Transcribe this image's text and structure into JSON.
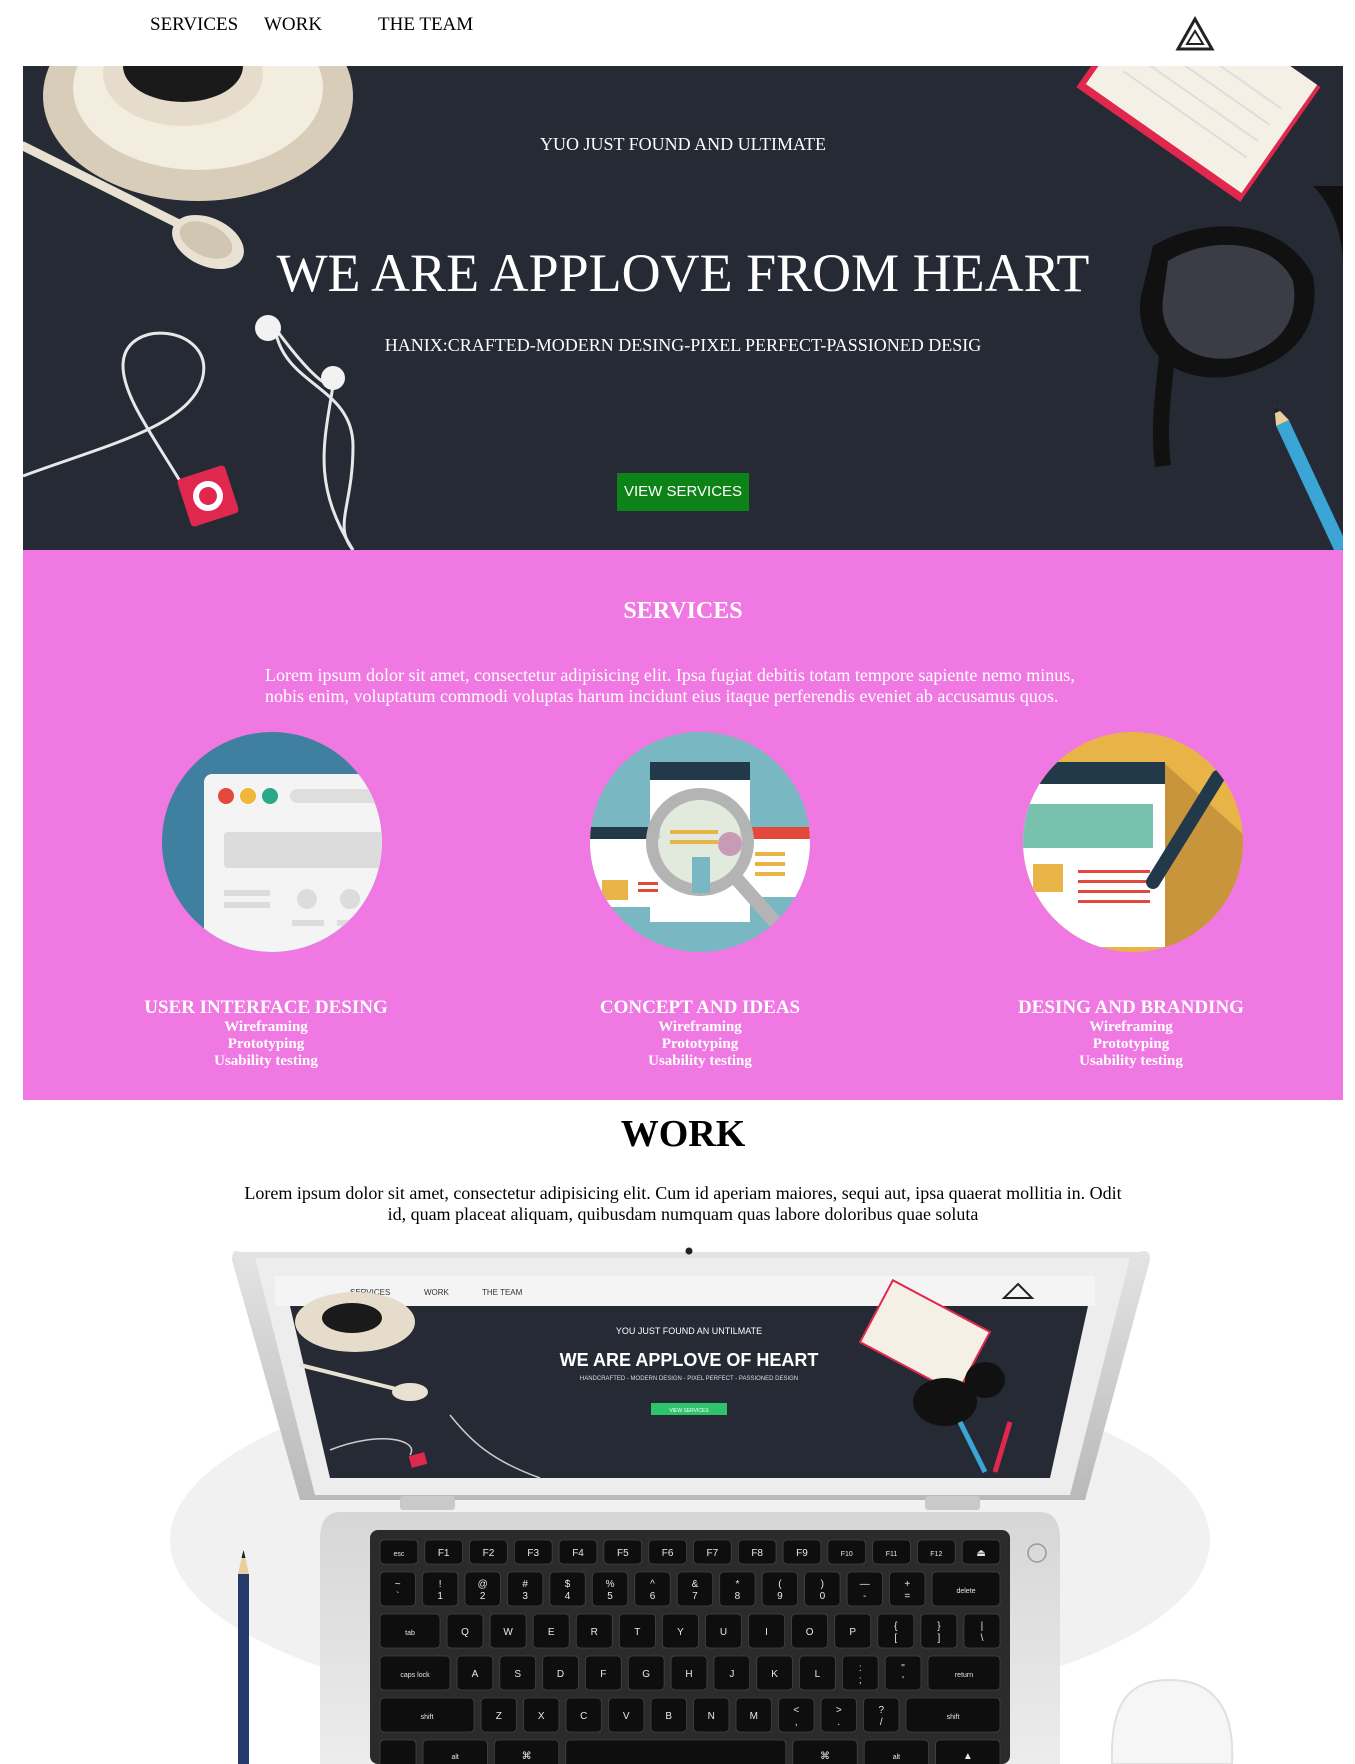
{
  "nav": {
    "items": [
      {
        "label": "SERVICES"
      },
      {
        "label": "WORK"
      },
      {
        "label": "THE TEAM"
      }
    ],
    "logo_icon": "triangle-logo-icon"
  },
  "hero": {
    "subtitle": "YUO JUST FOUND AND ULTIMATE",
    "title": "WE ARE APPLOVE FROM HEART",
    "tagline": "HANIX:CRAFTED-MODERN DESING-PIXEL PERFECT-PASSIONED DESIG",
    "button_label": "VIEW SERVICES",
    "background_color": "#262a35",
    "button_color": "#0d8217"
  },
  "services": {
    "heading": "SERVICES",
    "intro": "Lorem ipsum dolor sit amet, consectetur adipisicing elit. Ipsa fugiat debitis totam tempore sapiente nemo minus, nobis enim, voluptatum commodi voluptas harum incidunt eius itaque perferendis eveniet ab accusamus quos.",
    "background_color": "#f078e2",
    "cards": [
      {
        "title": "USER INTERFACE DESING",
        "icon": "browser-window-icon",
        "items": [
          "Wireframing",
          "Prototyping",
          "Usability testing"
        ]
      },
      {
        "title": "CONCEPT AND IDEAS",
        "icon": "magnifier-concept-icon",
        "items": [
          "Wireframing",
          "Prototyping",
          "Usability testing"
        ]
      },
      {
        "title": "DESING AND BRANDING",
        "icon": "pen-branding-icon",
        "items": [
          "Wireframing",
          "Prototyping",
          "Usability testing"
        ]
      }
    ]
  },
  "work": {
    "heading": "WORK",
    "intro": "Lorem ipsum dolor sit amet, consectetur adipisicing elit. Cum id aperiam maiores, sequi aut, ipsa quaerat mollitia in. Odit id, quam placeat aliquam, quibusdam numquam quas labore doloribus quae soluta",
    "laptop_screen": {
      "nav": [
        "SERVICES",
        "WORK",
        "THE TEAM"
      ],
      "subtitle": "YOU JUST FOUND AN UNTILMATE",
      "title": "WE ARE APPLOVE OF HEART",
      "tagline": "HANDCRAFTED - MODERN DESIGN - PIXEL PERFECT - PASSIONED DESIGN",
      "button_label": "VIEW SERVICES"
    },
    "keyboard": {
      "fn_row": [
        "esc",
        "F1",
        "F2",
        "F3",
        "F4",
        "F5",
        "F6",
        "F7",
        "F8",
        "F9",
        "F10",
        "F11",
        "F12",
        "⏏"
      ],
      "num_row": [
        "~\n`",
        "!\n1",
        "@\n2",
        "#\n3",
        "$\n4",
        "%\n5",
        "^\n6",
        "&\n7",
        "*\n8",
        "(\n9",
        ")\n0",
        "—\n-",
        "+\n=",
        "delete"
      ],
      "q_row": [
        "tab",
        "Q",
        "W",
        "E",
        "R",
        "T",
        "Y",
        "U",
        "I",
        "O",
        "P",
        "{\n[",
        "}\n]",
        "|\n\\"
      ],
      "a_row": [
        "caps lock",
        "A",
        "S",
        "D",
        "F",
        "G",
        "H",
        "J",
        "K",
        "L",
        ":\n;",
        "\"\n'",
        "return"
      ],
      "z_row": [
        "shift",
        "Z",
        "X",
        "C",
        "V",
        "B",
        "N",
        "M",
        "<\n,",
        ">\n.",
        "?\n/",
        "shift"
      ],
      "bottom_row": [
        "",
        "alt",
        "⌘",
        "",
        "⌘",
        "alt",
        "▲"
      ]
    }
  }
}
